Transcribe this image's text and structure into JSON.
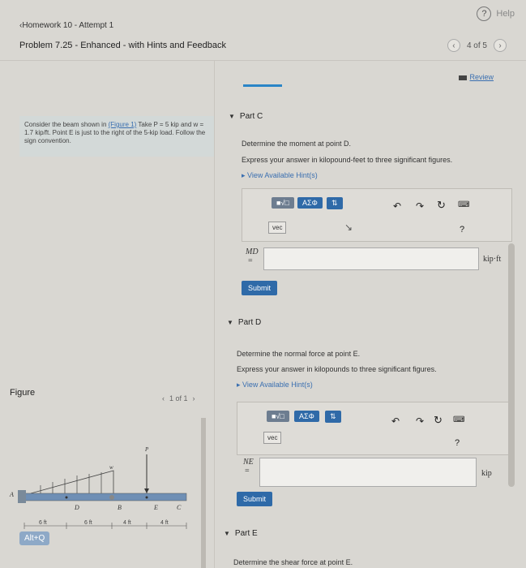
{
  "header": {
    "help_label": "Help",
    "back_label": "Homework 10 - Attempt 1",
    "title": "Problem 7.25 - Enhanced - with Hints and Feedback",
    "pager_text": "4 of 5",
    "review_label": "Review"
  },
  "problem": {
    "text1": "Consider the beam shown in",
    "figure_link": "(Figure 1)",
    "text2": "Take P = 5 kip and w = 1.7 kip/ft. Point E is just to the right of the 5-kip load. Follow the sign convention."
  },
  "partC": {
    "label": "Part C",
    "question": "Determine the moment at point D.",
    "instructions": "Express your answer in kilopound-feet to three significant figures.",
    "hint_label": "View Available Hint(s)",
    "toolbar": {
      "templates": "■√□",
      "greek": "ΑΣΦ",
      "sort": "⇅",
      "vec": "vec"
    },
    "var_label": "MD",
    "equals": "=",
    "answer_value": "",
    "unit": "kip·ft",
    "submit_label": "Submit"
  },
  "partD": {
    "label": "Part D",
    "question": "Determine the normal force at point E.",
    "instructions": "Express your answer in kilopounds to three significant figures.",
    "hint_label": "View Available Hint(s)",
    "toolbar": {
      "templates": "■√□",
      "greek": "ΑΣΦ",
      "sort": "⇅",
      "vec": "vec"
    },
    "var_label": "NE",
    "equals": "=",
    "answer_value": "",
    "unit": "kip",
    "submit_label": "Submit"
  },
  "partE": {
    "label": "Part E",
    "question": "Determine the shear force at point E."
  },
  "figure": {
    "label": "Figure",
    "pager": "1 of 1",
    "labels": {
      "A": "A",
      "D": "D",
      "B": "B",
      "E": "E",
      "C": "C",
      "w": "w",
      "P": "P"
    },
    "dims": [
      "6 ft",
      "6 ft",
      "4 ft",
      "4 ft"
    ]
  },
  "overlay": {
    "altq": "Alt+Q"
  }
}
